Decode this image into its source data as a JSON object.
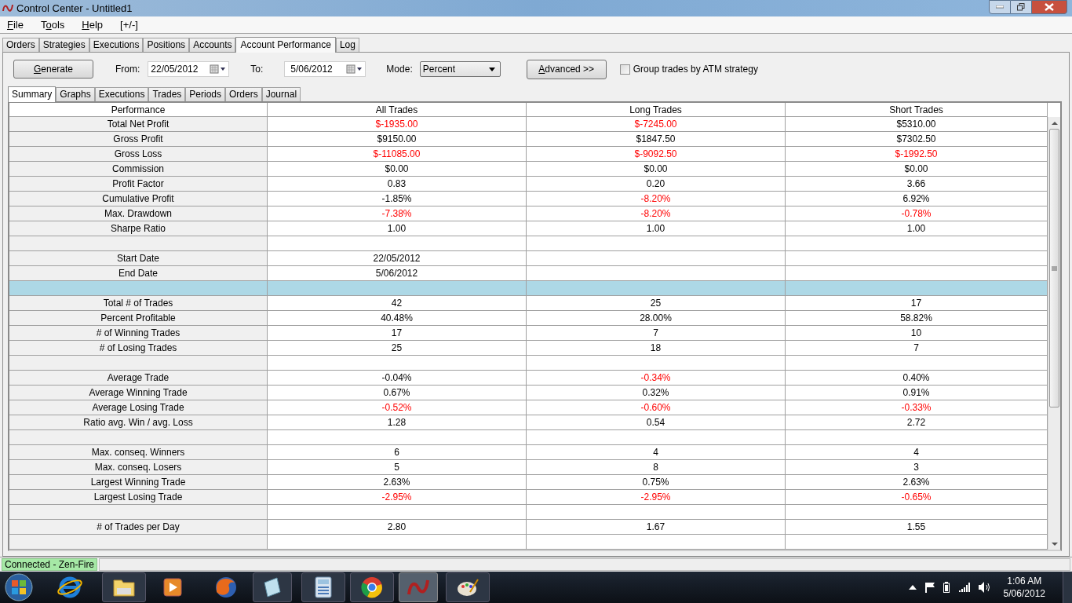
{
  "window": {
    "title": "Control Center - Untitled1"
  },
  "menu": [
    {
      "accel": "F",
      "rest": "ile"
    },
    {
      "pre": "T",
      "accel": "o",
      "rest": "ols"
    },
    {
      "accel": "H",
      "rest": "elp"
    },
    {
      "label": "[+/-]"
    }
  ],
  "tabs": [
    {
      "label": "Orders",
      "selected": false
    },
    {
      "label": "Strategies",
      "selected": false
    },
    {
      "label": "Executions",
      "selected": false
    },
    {
      "label": "Positions",
      "selected": false
    },
    {
      "label": "Accounts",
      "selected": false
    },
    {
      "label": "Account Performance",
      "selected": true
    },
    {
      "label": "Log",
      "selected": false
    }
  ],
  "toolbar": {
    "generate": {
      "accel": "G",
      "rest": "enerate"
    },
    "from_label": "From:",
    "from": "22/05/2012",
    "to_label": "To:",
    "to": "5/06/2012",
    "mode_label": "Mode:",
    "mode": "Percent",
    "advanced": {
      "accel": "A",
      "rest": "dvanced >>"
    },
    "group_by_atm": {
      "label": "Group trades by ATM strategy",
      "checked": false
    }
  },
  "subtabs": [
    {
      "label": "Summary",
      "selected": true
    },
    {
      "label": "Graphs",
      "selected": false
    },
    {
      "label": "Executions",
      "selected": false
    },
    {
      "label": "Trades",
      "selected": false
    },
    {
      "label": "Periods",
      "selected": false
    },
    {
      "label": "Orders",
      "selected": false
    },
    {
      "label": "Journal",
      "selected": false
    }
  ],
  "table": {
    "columns": [
      "Performance",
      "All Trades",
      "Long Trades",
      "Short Trades"
    ],
    "rows": [
      {
        "kind": "data",
        "selected": false,
        "label": "Total Net Profit",
        "cells": [
          {
            "text": "$-1935.00",
            "loss": true
          },
          {
            "text": "$-7245.00",
            "loss": true
          },
          {
            "text": "$5310.00",
            "loss": false
          }
        ]
      },
      {
        "kind": "data",
        "selected": false,
        "label": "Gross Profit",
        "cells": [
          {
            "text": "$9150.00",
            "loss": false
          },
          {
            "text": "$1847.50",
            "loss": false
          },
          {
            "text": "$7302.50",
            "loss": false
          }
        ]
      },
      {
        "kind": "data",
        "selected": false,
        "label": "Gross Loss",
        "cells": [
          {
            "text": "$-11085.00",
            "loss": true
          },
          {
            "text": "$-9092.50",
            "loss": true
          },
          {
            "text": "$-1992.50",
            "loss": true
          }
        ]
      },
      {
        "kind": "data",
        "selected": false,
        "label": "Commission",
        "cells": [
          {
            "text": "$0.00",
            "loss": false
          },
          {
            "text": "$0.00",
            "loss": false
          },
          {
            "text": "$0.00",
            "loss": false
          }
        ]
      },
      {
        "kind": "data",
        "selected": false,
        "label": "Profit Factor",
        "cells": [
          {
            "text": "0.83",
            "loss": false
          },
          {
            "text": "0.20",
            "loss": false
          },
          {
            "text": "3.66",
            "loss": false
          }
        ]
      },
      {
        "kind": "data",
        "selected": false,
        "label": "Cumulative Profit",
        "cells": [
          {
            "text": "-1.85%",
            "loss": false
          },
          {
            "text": "-8.20%",
            "loss": true
          },
          {
            "text": "6.92%",
            "loss": false
          }
        ]
      },
      {
        "kind": "data",
        "selected": false,
        "label": "Max. Drawdown",
        "cells": [
          {
            "text": "-7.38%",
            "loss": true
          },
          {
            "text": "-8.20%",
            "loss": true
          },
          {
            "text": "-0.78%",
            "loss": true
          }
        ]
      },
      {
        "kind": "data",
        "selected": false,
        "label": "Sharpe Ratio",
        "cells": [
          {
            "text": "1.00",
            "loss": false
          },
          {
            "text": "1.00",
            "loss": false
          },
          {
            "text": "1.00",
            "loss": false
          }
        ]
      },
      {
        "kind": "blank",
        "selected": false
      },
      {
        "kind": "data",
        "selected": false,
        "label": "Start Date",
        "cells": [
          {
            "text": "22/05/2012",
            "loss": false
          },
          null,
          null
        ]
      },
      {
        "kind": "data",
        "selected": false,
        "label": "End Date",
        "cells": [
          {
            "text": "5/06/2012",
            "loss": false
          },
          null,
          null
        ]
      },
      {
        "kind": "blank",
        "selected": true
      },
      {
        "kind": "data",
        "selected": false,
        "label": "Total # of Trades",
        "cells": [
          {
            "text": "42",
            "loss": false
          },
          {
            "text": "25",
            "loss": false
          },
          {
            "text": "17",
            "loss": false
          }
        ]
      },
      {
        "kind": "data",
        "selected": false,
        "label": "Percent Profitable",
        "cells": [
          {
            "text": "40.48%",
            "loss": false
          },
          {
            "text": "28.00%",
            "loss": false
          },
          {
            "text": "58.82%",
            "loss": false
          }
        ]
      },
      {
        "kind": "data",
        "selected": false,
        "label": "# of Winning Trades",
        "cells": [
          {
            "text": "17",
            "loss": false
          },
          {
            "text": "7",
            "loss": false
          },
          {
            "text": "10",
            "loss": false
          }
        ]
      },
      {
        "kind": "data",
        "selected": false,
        "label": "# of Losing Trades",
        "cells": [
          {
            "text": "25",
            "loss": false
          },
          {
            "text": "18",
            "loss": false
          },
          {
            "text": "7",
            "loss": false
          }
        ]
      },
      {
        "kind": "blank",
        "selected": false
      },
      {
        "kind": "data",
        "selected": false,
        "label": "Average Trade",
        "cells": [
          {
            "text": "-0.04%",
            "loss": false
          },
          {
            "text": "-0.34%",
            "loss": true
          },
          {
            "text": "0.40%",
            "loss": false
          }
        ]
      },
      {
        "kind": "data",
        "selected": false,
        "label": "Average Winning Trade",
        "cells": [
          {
            "text": "0.67%",
            "loss": false
          },
          {
            "text": "0.32%",
            "loss": false
          },
          {
            "text": "0.91%",
            "loss": false
          }
        ]
      },
      {
        "kind": "data",
        "selected": false,
        "label": "Average Losing Trade",
        "cells": [
          {
            "text": "-0.52%",
            "loss": true
          },
          {
            "text": "-0.60%",
            "loss": true
          },
          {
            "text": "-0.33%",
            "loss": true
          }
        ]
      },
      {
        "kind": "data",
        "selected": false,
        "label": "Ratio avg. Win / avg. Loss",
        "cells": [
          {
            "text": "1.28",
            "loss": false
          },
          {
            "text": "0.54",
            "loss": false
          },
          {
            "text": "2.72",
            "loss": false
          }
        ]
      },
      {
        "kind": "blank",
        "selected": false
      },
      {
        "kind": "data",
        "selected": false,
        "label": "Max. conseq. Winners",
        "cells": [
          {
            "text": "6",
            "loss": false
          },
          {
            "text": "4",
            "loss": false
          },
          {
            "text": "4",
            "loss": false
          }
        ]
      },
      {
        "kind": "data",
        "selected": false,
        "label": "Max. conseq. Losers",
        "cells": [
          {
            "text": "5",
            "loss": false
          },
          {
            "text": "8",
            "loss": false
          },
          {
            "text": "3",
            "loss": false
          }
        ]
      },
      {
        "kind": "data",
        "selected": false,
        "label": "Largest Winning Trade",
        "cells": [
          {
            "text": "2.63%",
            "loss": false
          },
          {
            "text": "0.75%",
            "loss": false
          },
          {
            "text": "2.63%",
            "loss": false
          }
        ]
      },
      {
        "kind": "data",
        "selected": false,
        "label": "Largest Losing Trade",
        "cells": [
          {
            "text": "-2.95%",
            "loss": true
          },
          {
            "text": "-2.95%",
            "loss": true
          },
          {
            "text": "-0.65%",
            "loss": true
          }
        ]
      },
      {
        "kind": "blank",
        "selected": false
      },
      {
        "kind": "data",
        "selected": false,
        "label": "# of Trades per Day",
        "cells": [
          {
            "text": "2.80",
            "loss": false
          },
          {
            "text": "1.67",
            "loss": false
          },
          {
            "text": "1.55",
            "loss": false
          }
        ]
      },
      {
        "kind": "blank",
        "selected": false
      }
    ]
  },
  "status_bar": {
    "connection": "Connected - Zen-Fire"
  },
  "taskbar": {
    "time": "1:06 AM",
    "date": "5/06/2012"
  }
}
